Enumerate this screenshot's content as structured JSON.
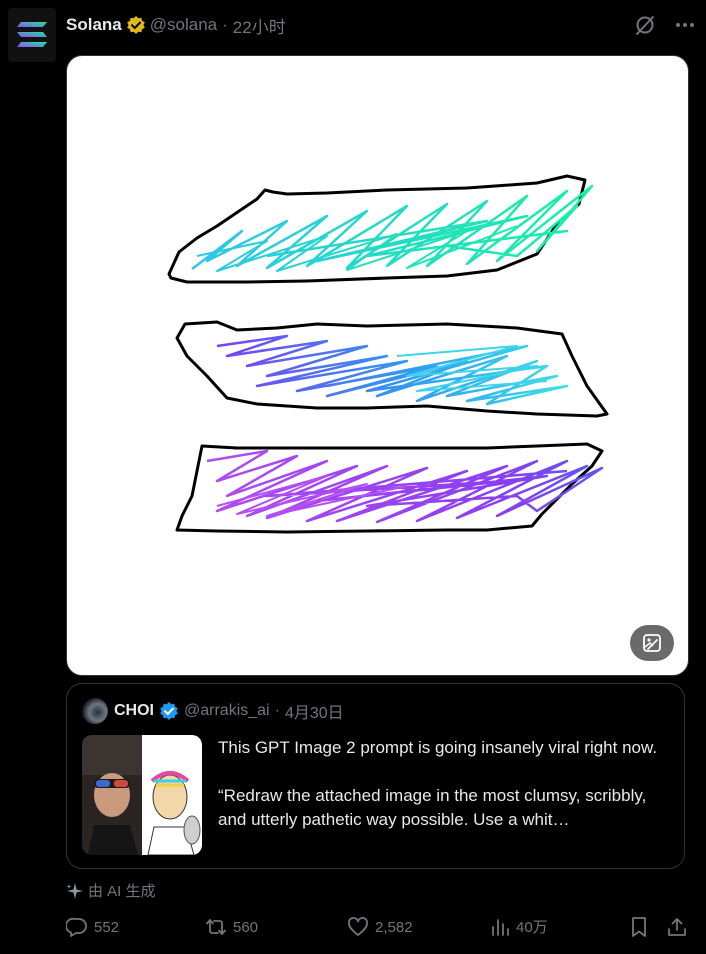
{
  "post": {
    "author_name": "Solana",
    "handle": "@solana",
    "separator": "·",
    "time": "22小时"
  },
  "quote": {
    "author_name": "CHOI",
    "handle": "@arrakis_ai",
    "separator": "·",
    "date": "4月30日",
    "text_line1": "This GPT Image 2 prompt is going insanely viral right now.",
    "text_line2": "“Redraw the attached image in the most clumsy, scribbly, and utterly pathetic way possible. Use a whit…"
  },
  "ai_label": "由 AI 生成",
  "actions": {
    "replies": "552",
    "reposts": "560",
    "likes": "2,582",
    "views": "40万"
  },
  "colors": {
    "background": "#000000",
    "text": "#e7e9ea",
    "muted": "#71767b",
    "verified_gold": "#e2b719",
    "verified_blue": "#1d9bf0"
  },
  "icons": [
    "solana-logo-icon",
    "gold-verified-icon",
    "grok-icon",
    "more-icon",
    "edit-image-icon",
    "blue-verified-icon",
    "sparkle-icon",
    "reply-icon",
    "repost-icon",
    "like-icon",
    "views-icon",
    "bookmark-icon",
    "share-icon"
  ]
}
